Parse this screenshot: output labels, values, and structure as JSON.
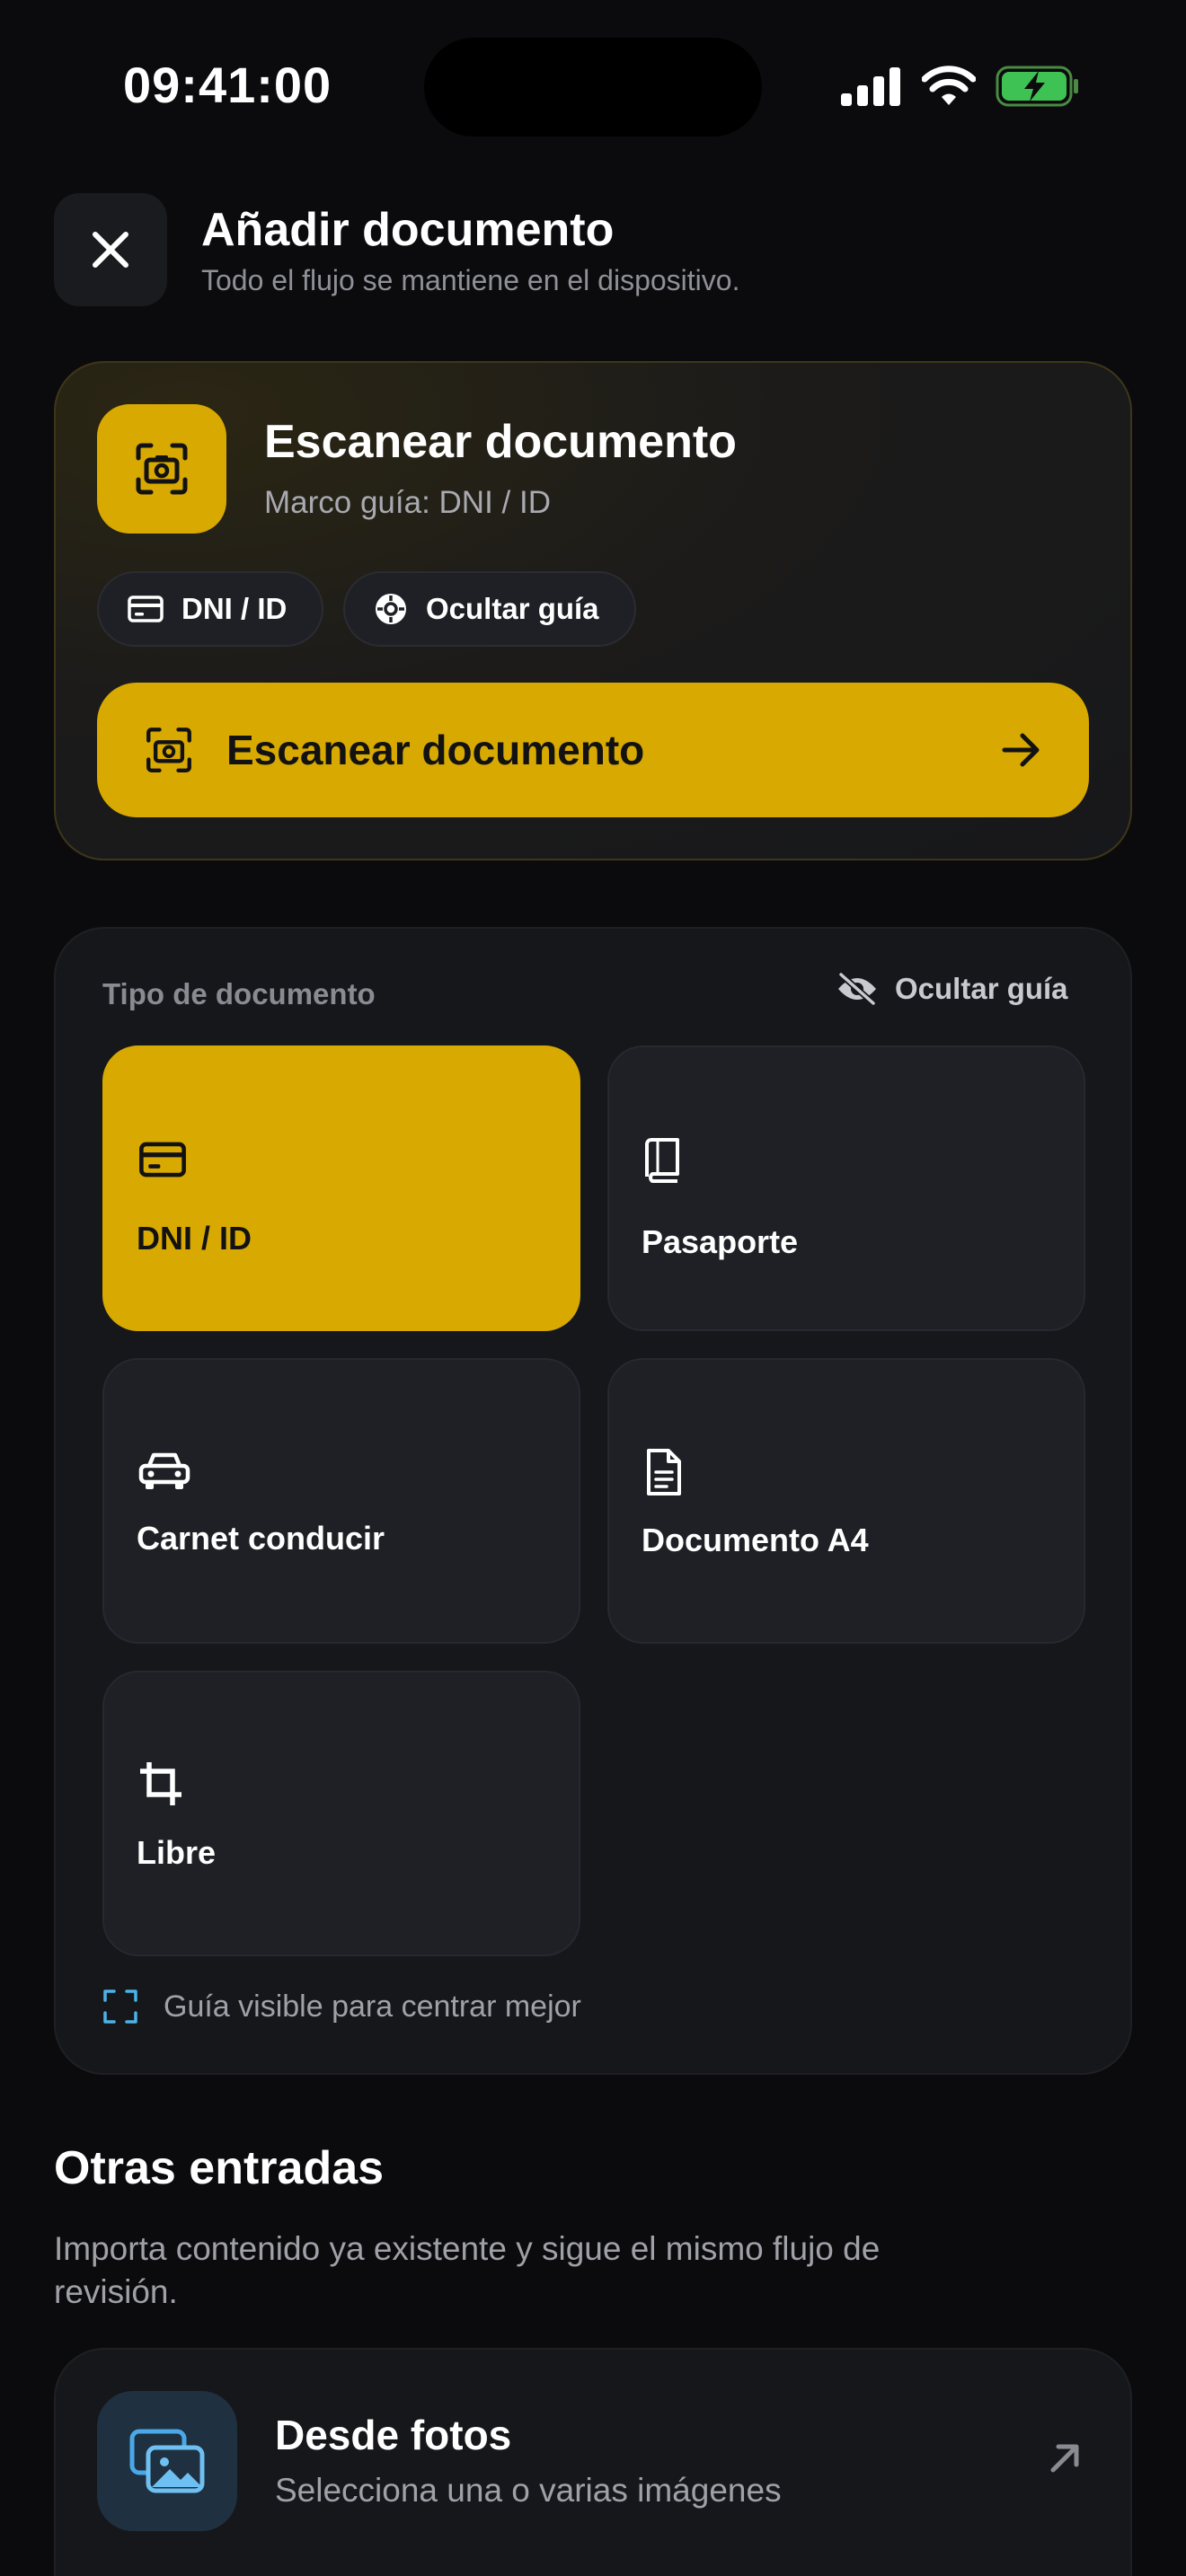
{
  "status_bar": {
    "time": "09:41:00"
  },
  "header": {
    "title": "Añadir documento",
    "subtitle": "Todo el flujo se mantiene en el dispositivo."
  },
  "scan_card": {
    "title": "Escanear documento",
    "subtitle": "Marco guía: DNI / ID",
    "chip_type": "DNI / ID",
    "chip_guide": "Ocultar guía",
    "button_label": "Escanear documento",
    "accent_color": "#d8a900"
  },
  "document_type": {
    "label": "Tipo de documento",
    "hide_guide": "Ocultar guía",
    "selected": "DNI / ID",
    "options": [
      {
        "label": "DNI / ID",
        "icon": "id-card-icon"
      },
      {
        "label": "Pasaporte",
        "icon": "passport-icon"
      },
      {
        "label": "Carnet conducir",
        "icon": "car-icon"
      },
      {
        "label": "Documento A4",
        "icon": "document-icon"
      },
      {
        "label": "Libre",
        "icon": "crop-icon"
      }
    ],
    "hint": "Guía visible para centrar mejor"
  },
  "other_entries": {
    "title": "Otras entradas",
    "description": "Importa contenido ya existente y sigue el mismo flujo de revisión.",
    "photos": {
      "title": "Desde fotos",
      "subtitle": "Selecciona una o varias imágenes"
    }
  }
}
